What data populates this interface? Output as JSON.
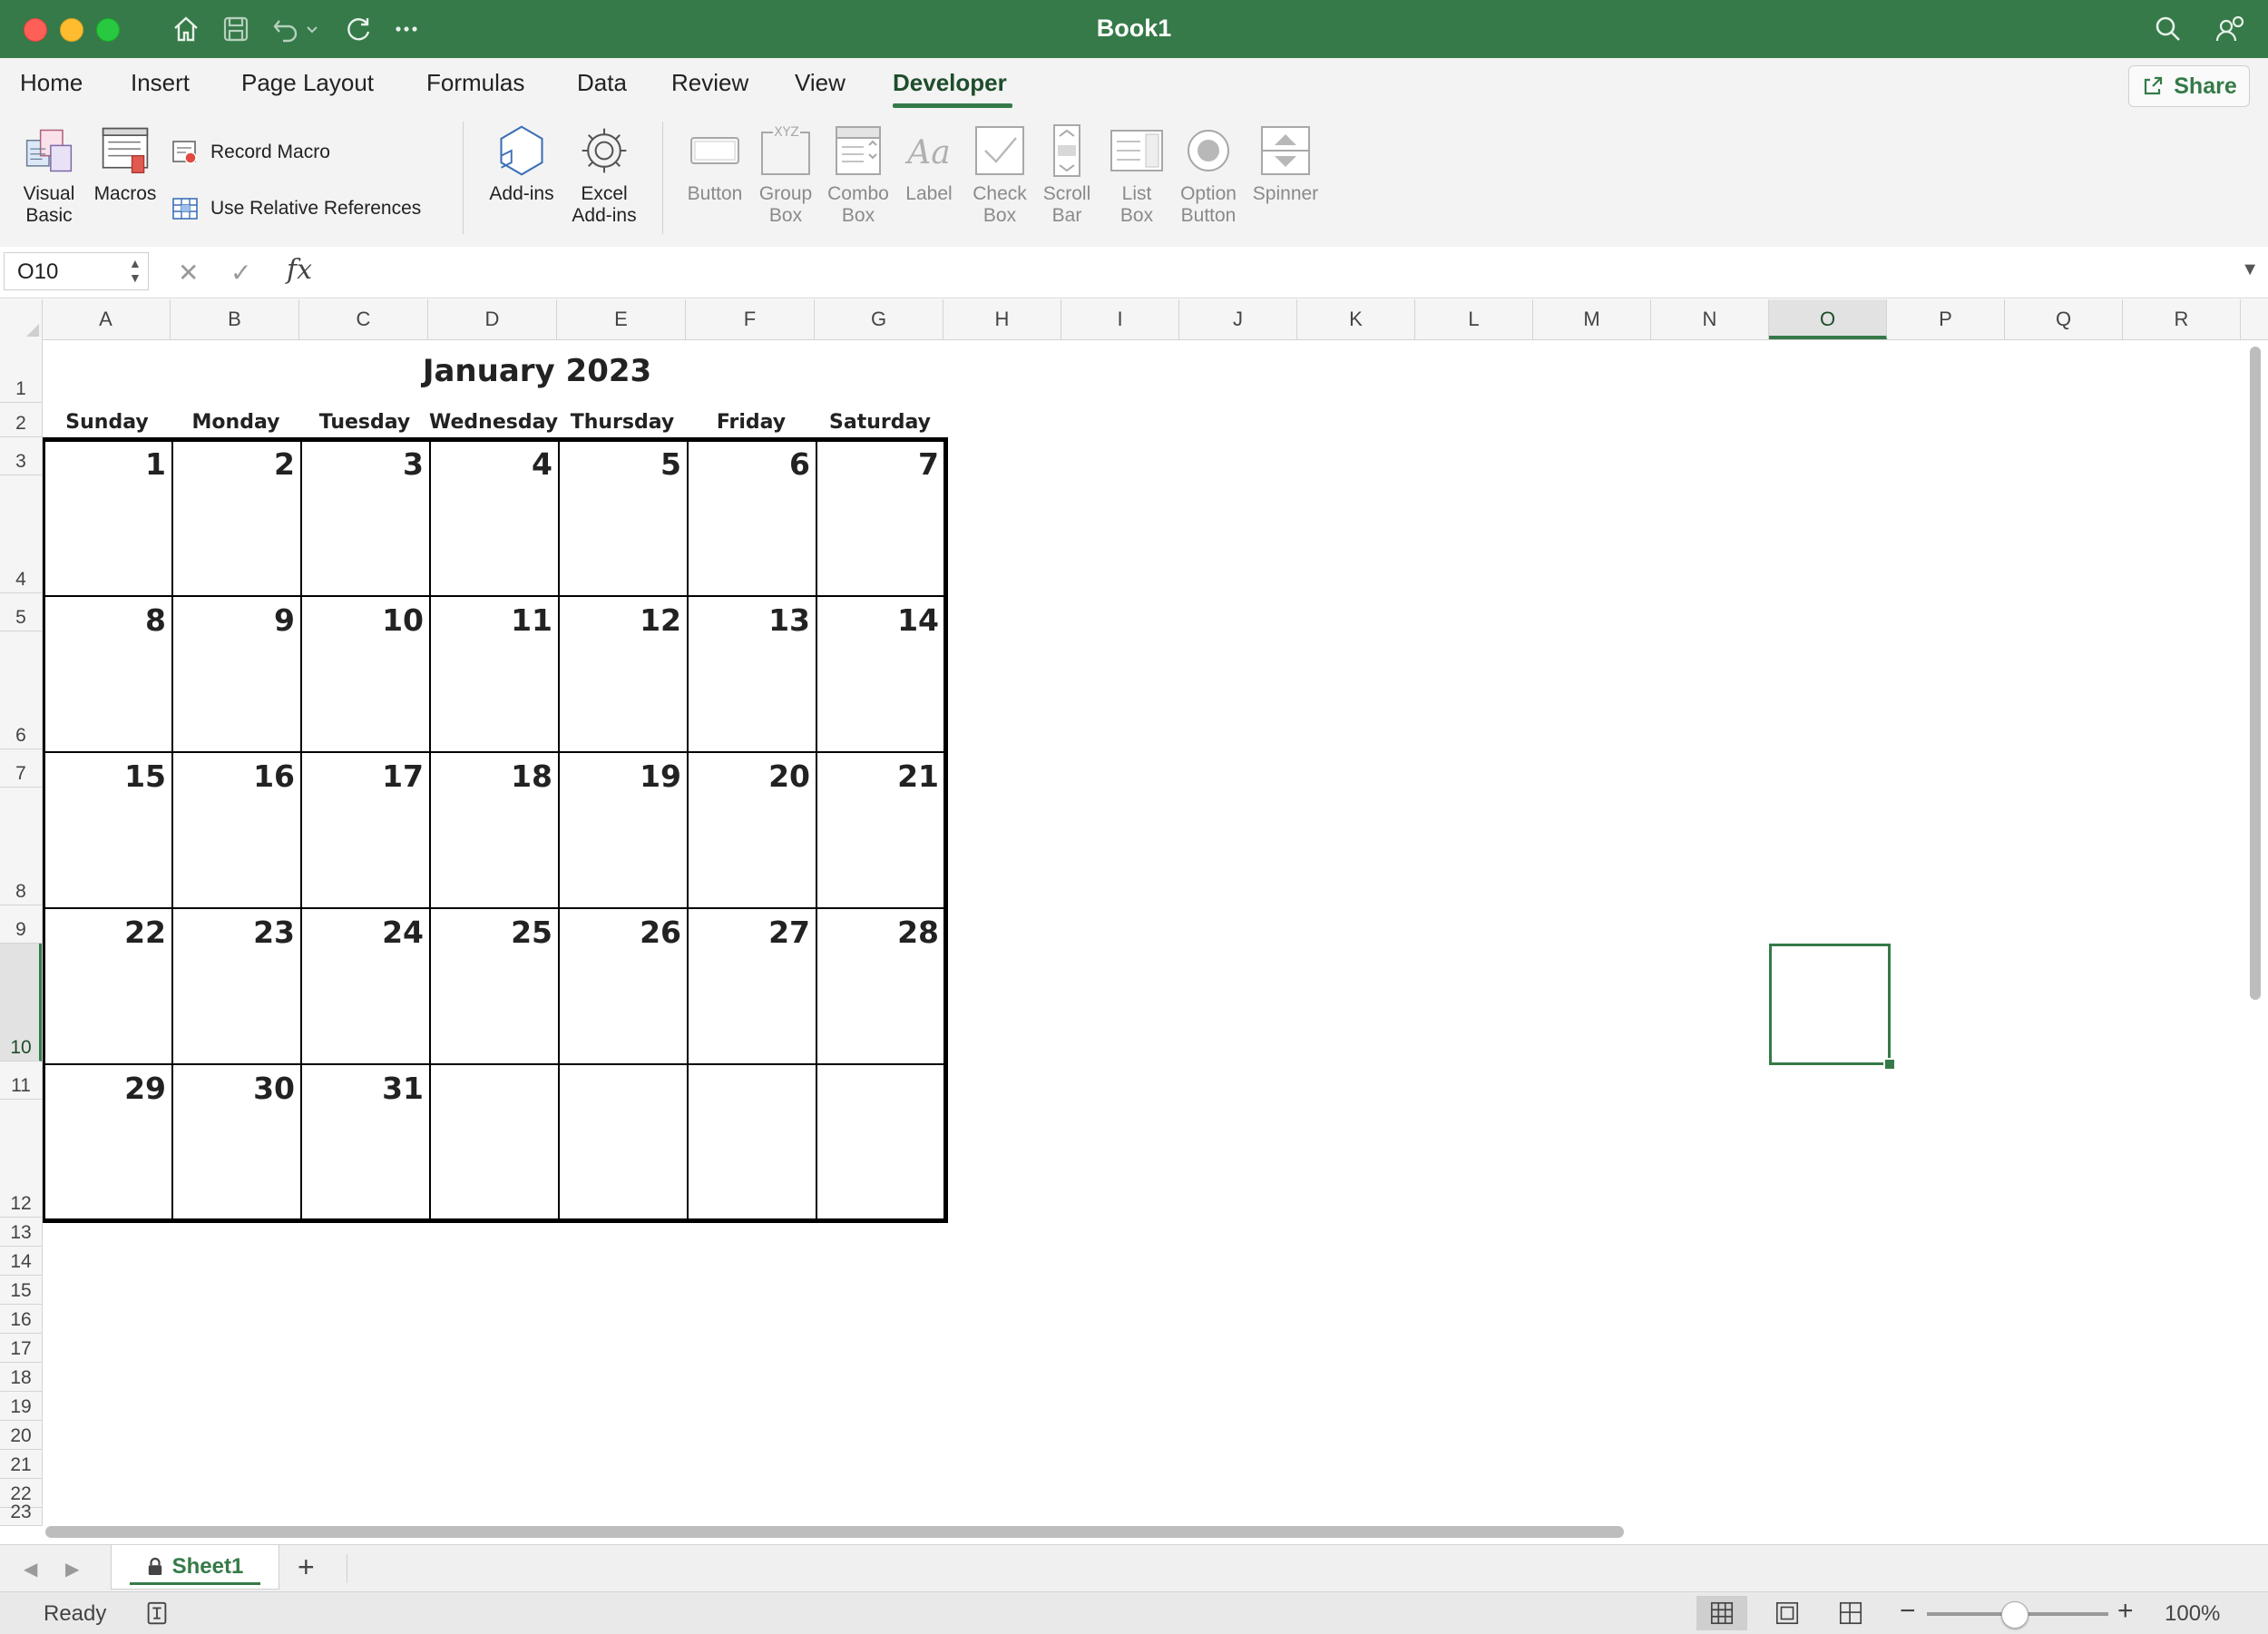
{
  "window": {
    "title": "Book1"
  },
  "menu": {
    "tabs": [
      {
        "label": "Home"
      },
      {
        "label": "Insert"
      },
      {
        "label": "Page Layout"
      },
      {
        "label": "Formulas"
      },
      {
        "label": "Data"
      },
      {
        "label": "Review"
      },
      {
        "label": "View"
      },
      {
        "label": "Developer",
        "active": true
      }
    ],
    "share_label": "Share"
  },
  "ribbon": {
    "visual_basic": "Visual Basic",
    "macros": "Macros",
    "record_macro": "Record Macro",
    "use_relative_references": "Use Relative References",
    "add_ins": "Add-ins",
    "excel_add_ins": "Excel Add-ins",
    "form_controls": [
      {
        "label": "Button"
      },
      {
        "label": "Group Box"
      },
      {
        "label": "Combo Box"
      },
      {
        "label": "Label"
      },
      {
        "label": "Check Box"
      },
      {
        "label": "Scroll Bar"
      },
      {
        "label": "List Box"
      },
      {
        "label": "Option Button"
      },
      {
        "label": "Spinner"
      }
    ]
  },
  "formula_bar": {
    "name_box": "O10",
    "fx_label": "fx",
    "formula": ""
  },
  "grid": {
    "columns": [
      "A",
      "B",
      "C",
      "D",
      "E",
      "F",
      "G",
      "H",
      "I",
      "J",
      "K",
      "L",
      "M",
      "N",
      "O",
      "P",
      "Q",
      "R"
    ],
    "rows": [
      "1",
      "2",
      "3",
      "4",
      "5",
      "6",
      "7",
      "8",
      "9",
      "10",
      "11",
      "12",
      "13",
      "14",
      "15",
      "16",
      "17",
      "18",
      "19",
      "20",
      "21",
      "22",
      "23"
    ],
    "selected_column": "O",
    "selected_row": "10"
  },
  "calendar": {
    "title": "January 2023",
    "days": [
      "Sunday",
      "Monday",
      "Tuesday",
      "Wednesday",
      "Thursday",
      "Friday",
      "Saturday"
    ],
    "weeks": [
      [
        "1",
        "2",
        "3",
        "4",
        "5",
        "6",
        "7"
      ],
      [
        "8",
        "9",
        "10",
        "11",
        "12",
        "13",
        "14"
      ],
      [
        "15",
        "16",
        "17",
        "18",
        "19",
        "20",
        "21"
      ],
      [
        "22",
        "23",
        "24",
        "25",
        "26",
        "27",
        "28"
      ],
      [
        "29",
        "30",
        "31",
        "",
        "",
        "",
        ""
      ]
    ]
  },
  "sheet_tabs": {
    "active": "Sheet1",
    "add_label": "+"
  },
  "status": {
    "text": "Ready",
    "zoom": "100%"
  },
  "colors": {
    "accent": "#357a48"
  }
}
